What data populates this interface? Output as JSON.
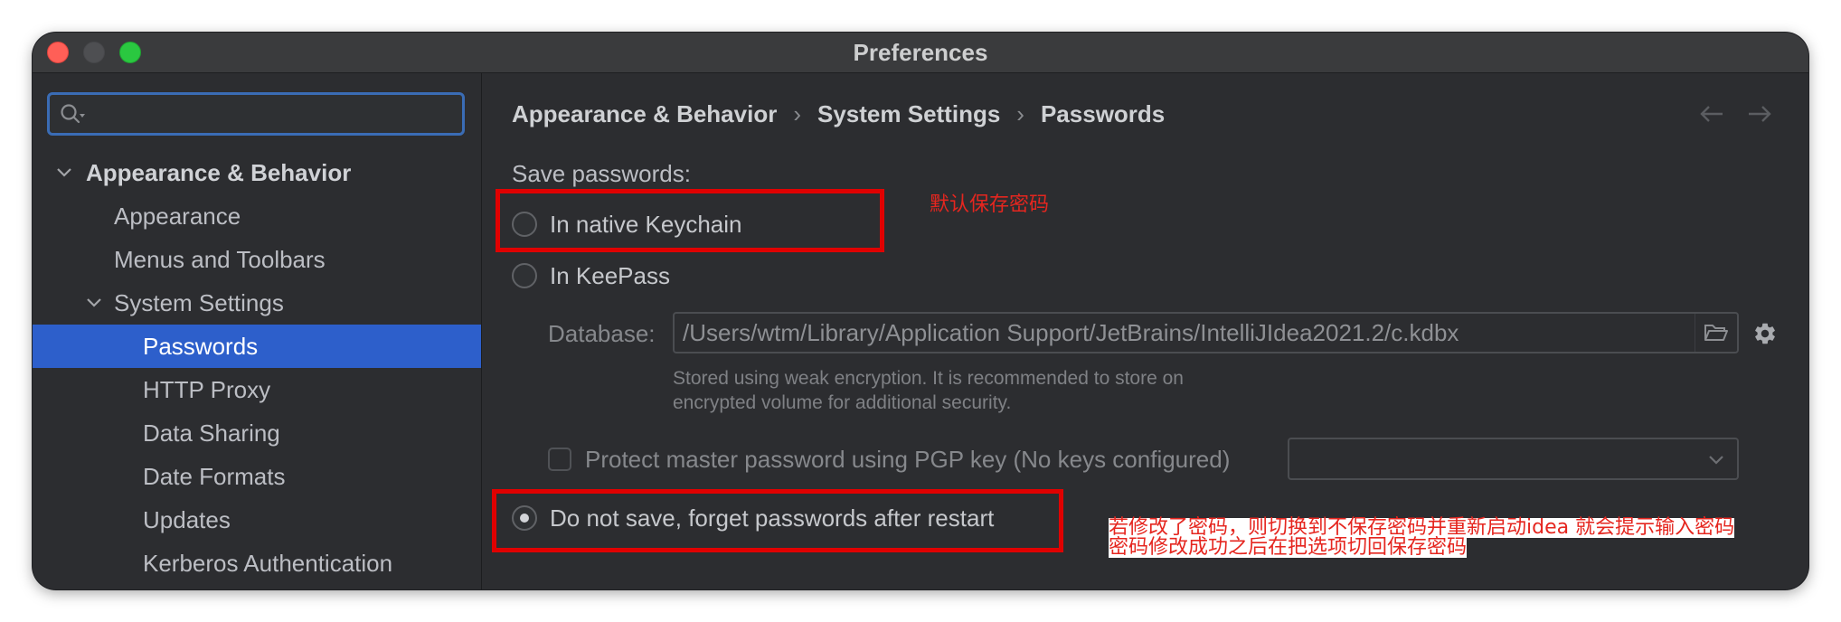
{
  "window": {
    "title": "Preferences"
  },
  "sidebar": {
    "tree": [
      {
        "label": "Appearance & Behavior",
        "expanded": true,
        "children": [
          {
            "label": "Appearance"
          },
          {
            "label": "Menus and Toolbars"
          },
          {
            "label": "System Settings",
            "expanded": true,
            "children": [
              {
                "label": "Passwords",
                "selected": true
              },
              {
                "label": "HTTP Proxy"
              },
              {
                "label": "Data Sharing"
              },
              {
                "label": "Date Formats"
              },
              {
                "label": "Updates"
              },
              {
                "label": "Kerberos Authentication"
              }
            ]
          }
        ]
      }
    ]
  },
  "breadcrumb": {
    "separator": "›",
    "items": [
      "Appearance & Behavior",
      "System Settings",
      "Passwords"
    ]
  },
  "passwords": {
    "save_label": "Save passwords:",
    "options": [
      {
        "label": "In native Keychain",
        "selected": false
      },
      {
        "label": "In KeePass",
        "selected": false
      },
      {
        "label": "Do not save, forget passwords after restart",
        "selected": true
      }
    ],
    "database_label": "Database:",
    "database_path": "/Users/wtm/Library/Application Support/JetBrains/IntelliJIdea2021.2/c.kdbx",
    "note_lines": [
      "Stored using weak encryption. It is recommended to store on",
      "encrypted volume for additional security."
    ],
    "pgp_label": "Protect master password using PGP key (No keys configured)",
    "pgp_checked": false
  },
  "annotations": {
    "keychain_note": "默认保存密码",
    "do_not_save_note_lines": [
      "若修改了密码，则切换到不保存密码并重新启动idea 就会提示输入密码",
      "密码修改成功之后在把选项切回保存密码"
    ]
  },
  "icons": {
    "close": "close-window-icon",
    "minimize": "minimize-window-icon",
    "zoom": "zoom-window-icon",
    "search": "search-icon",
    "expand": "chevron-down-icon",
    "back": "arrow-left-icon",
    "forward": "arrow-right-icon",
    "browse": "folder-icon",
    "settings": "gear-icon",
    "dropdown": "dropdown-arrow-icon"
  },
  "colors": {
    "selection": "#2d5fcb",
    "annotation_red": "#e5261f",
    "close": "#ff5f57",
    "minimize": "#4e4f52",
    "zoom": "#2ac840",
    "focus_ring": "#3a6cb5"
  }
}
